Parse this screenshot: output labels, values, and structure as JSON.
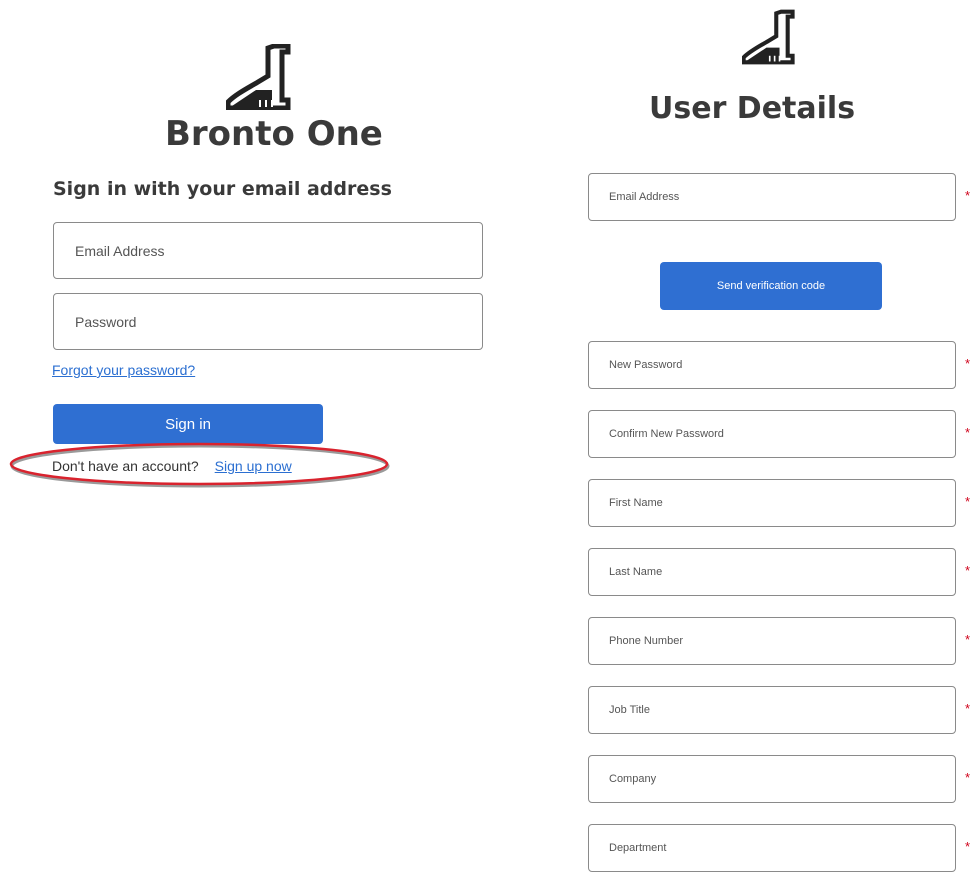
{
  "signin_page": {
    "title": "Bronto One",
    "subtitle": "Sign in with your email address",
    "email_placeholder": "Email Address",
    "password_placeholder": "Password",
    "forgot_password_link": "Forgot your password?",
    "signin_button": "Sign in",
    "no_account_text": "Don't have an account?",
    "signup_link": "Sign up now",
    "logo_icon": "brontosaurus-logo-icon"
  },
  "signup_page": {
    "title": "User Details",
    "logo_icon": "brontosaurus-logo-icon",
    "send_code_button": "Send verification code",
    "required_marker": "*",
    "fields": [
      {
        "placeholder": "Email Address"
      },
      {
        "placeholder": "New Password"
      },
      {
        "placeholder": "Confirm New Password"
      },
      {
        "placeholder": "First Name"
      },
      {
        "placeholder": "Last Name"
      },
      {
        "placeholder": "Phone Number"
      },
      {
        "placeholder": "Job Title"
      },
      {
        "placeholder": "Company"
      },
      {
        "placeholder": "Department"
      }
    ]
  },
  "colors": {
    "primary_button": "#2f6fd2",
    "link": "#2b6fd1",
    "required_marker": "#d0021b",
    "highlight_ellipse": "#d9232e"
  }
}
